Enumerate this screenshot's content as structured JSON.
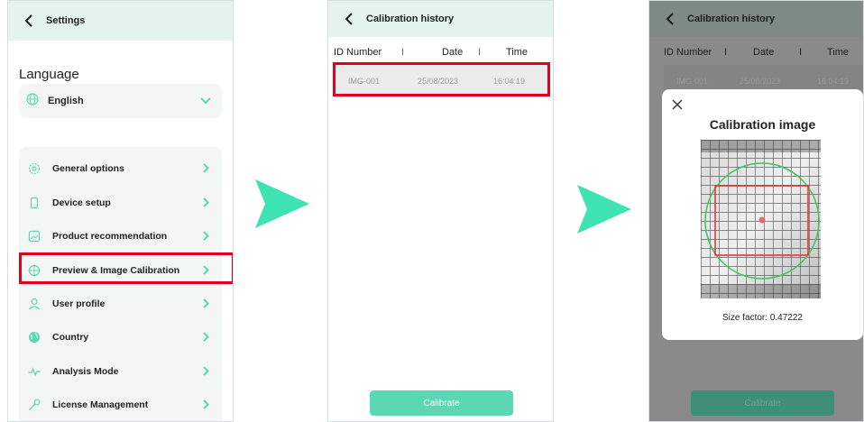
{
  "colors": {
    "accent": "#5cd6b4",
    "highlight": "#e0001b",
    "header": "#e4f3ee",
    "arrow": "#3fe3b3"
  },
  "settings": {
    "title": "Settings",
    "language_label": "Language",
    "language_value": "English",
    "menu": [
      {
        "label": "General options",
        "icon": "gear-icon"
      },
      {
        "label": "Device setup",
        "icon": "device-icon"
      },
      {
        "label": "Product recommendation",
        "icon": "image-icon"
      },
      {
        "label": "Preview & Image Calibration",
        "icon": "target-icon"
      },
      {
        "label": "User profile",
        "icon": "user-icon"
      },
      {
        "label": "Country",
        "icon": "globe-icon"
      },
      {
        "label": "Analysis Mode",
        "icon": "pulse-icon"
      },
      {
        "label": "License Management",
        "icon": "key-icon"
      }
    ]
  },
  "history": {
    "title": "Calibration history",
    "columns": [
      "ID Number",
      "Date",
      "Time"
    ],
    "separator": "I",
    "rows": [
      {
        "id": "IMG-001",
        "date": "25/08/2023",
        "time": "16:04:19"
      }
    ],
    "calibrate_label": "Calibrate"
  },
  "modal": {
    "title": "Calibration image",
    "size_factor": "Size factor: 0.47222"
  }
}
